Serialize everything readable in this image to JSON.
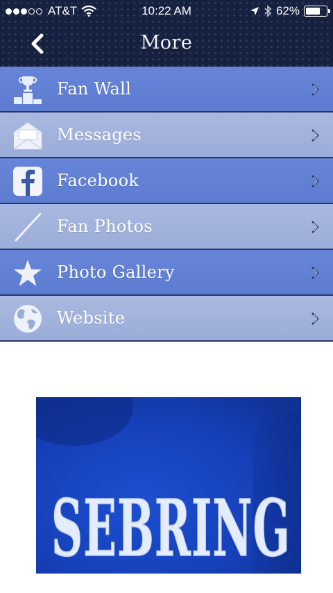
{
  "status_bar": {
    "carrier": "AT&T",
    "time": "10:22 AM",
    "battery": "62%"
  },
  "nav": {
    "title": "More",
    "back_icon": "chevron-left-icon"
  },
  "menu": {
    "items": [
      {
        "label": "Fan Wall",
        "icon": "trophy-podium-icon"
      },
      {
        "label": "Messages",
        "icon": "envelope-icon"
      },
      {
        "label": "Facebook",
        "icon": "facebook-icon"
      },
      {
        "label": "Fan Photos",
        "icon": "slash-icon"
      },
      {
        "label": "Photo Gallery",
        "icon": "star-icon"
      },
      {
        "label": "Website",
        "icon": "globe-icon"
      }
    ]
  },
  "banner": {
    "text": "SEBRING"
  },
  "colors": {
    "nav_background": "#16213f",
    "row_dark": "#6080d5",
    "row_light": "#a3b3dd",
    "banner_blue": "#1845c0"
  }
}
